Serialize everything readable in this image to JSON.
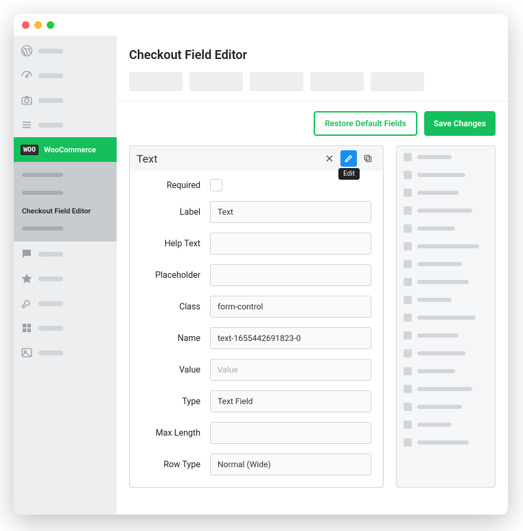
{
  "sidebar": {
    "woo_badge": "WOO",
    "woo_label": "WooCommerce",
    "submenu_current": "Checkout Field Editor"
  },
  "page": {
    "title": "Checkout Field Editor"
  },
  "actions": {
    "restore": "Restore Default Fields",
    "save": "Save Changes"
  },
  "editor": {
    "title": "Text",
    "tooltip_edit": "Edit",
    "fields": {
      "required_label": "Required",
      "label_label": "Label",
      "label_value": "Text",
      "help_label": "Help Text",
      "help_value": "",
      "placeholder_label": "Placeholder",
      "placeholder_value": "",
      "class_label": "Class",
      "class_value": "form-control",
      "name_label": "Name",
      "name_value": "text-1655442691823-0",
      "value_label": "Value",
      "value_placeholder": "Value",
      "type_label": "Type",
      "type_value": "Text Field",
      "maxlen_label": "Max Length",
      "maxlen_value": "",
      "rowtype_label": "Row Type",
      "rowtype_value": "Normal (Wide)"
    }
  }
}
